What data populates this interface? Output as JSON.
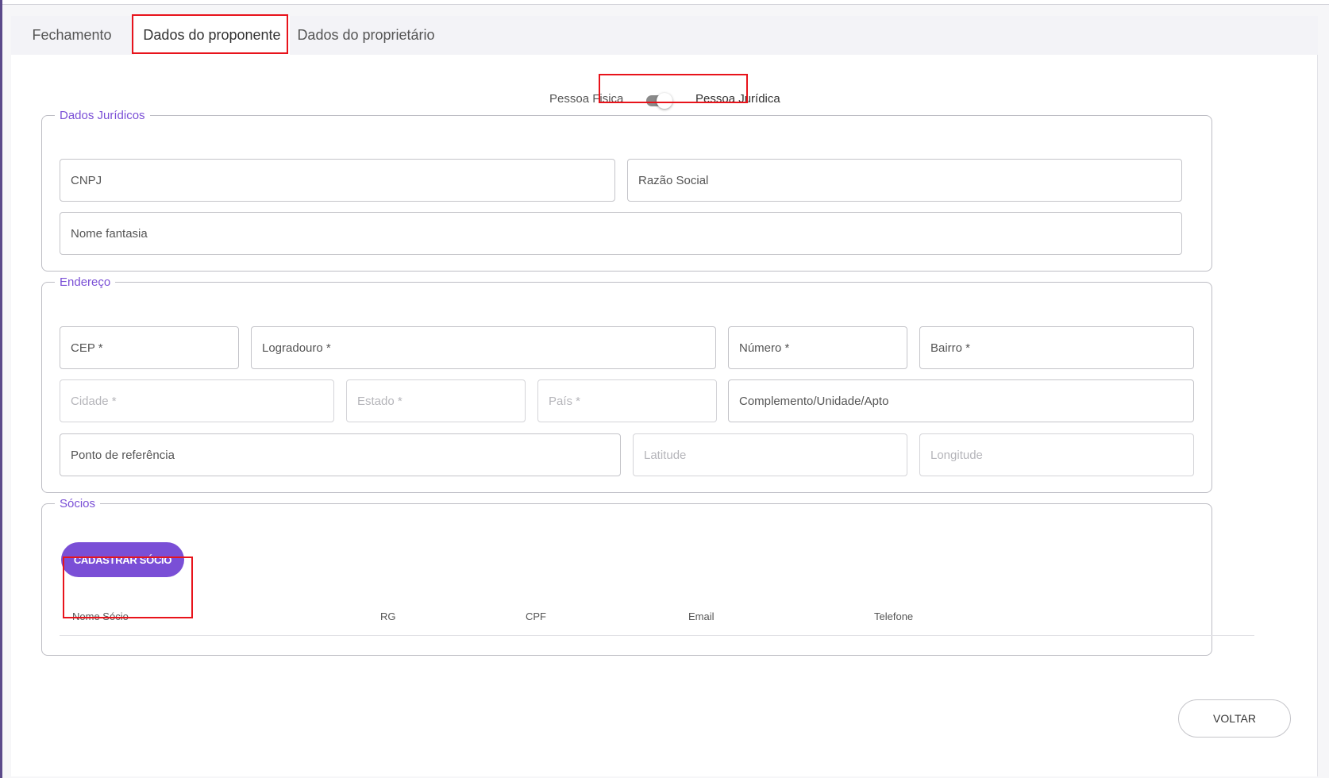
{
  "tabs": [
    {
      "label": "Fechamento",
      "active": false
    },
    {
      "label": "Dados do proponente",
      "active": true
    },
    {
      "label": "Dados do proprietário",
      "active": false
    }
  ],
  "person_type": {
    "left_label": "Pessoa Fisica",
    "right_label": "Pessoa Jurídica",
    "selected": "Pessoa Jurídica"
  },
  "juridicos": {
    "legend": "Dados Jurídicos",
    "cnpj": "CNPJ",
    "razao_social": "Razão Social",
    "nome_fantasia": "Nome fantasia"
  },
  "endereco": {
    "legend": "Endereço",
    "cep": "CEP *",
    "logradouro": "Logradouro *",
    "numero": "Número *",
    "bairro": "Bairro *",
    "cidade": "Cidade *",
    "estado": "Estado *",
    "pais": "País *",
    "complemento": "Complemento/Unidade/Apto",
    "ponto_referencia": "Ponto de referência",
    "latitude": "Latitude",
    "longitude": "Longitude"
  },
  "socios": {
    "legend": "Sócios",
    "add_button": "CADASTRAR SÓCIO",
    "columns": [
      "Nome Sócio",
      "RG",
      "CPF",
      "Email",
      "Telefone"
    ]
  },
  "footer": {
    "back_button": "VOLTAR"
  },
  "colors": {
    "accent": "#7a4fd6",
    "highlight": "#e8131b"
  }
}
